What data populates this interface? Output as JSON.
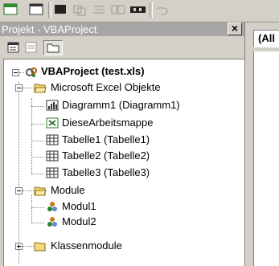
{
  "panel": {
    "title": "Projekt - VBAProject",
    "close_label": "×"
  },
  "code_window": {
    "object_combo": "(All"
  },
  "tree": {
    "project": "VBAProject (test.xls)",
    "excel_objects_folder": "Microsoft Excel Objekte",
    "excel_objects": [
      "Diagramm1 (Diagramm1)",
      "DieseArbeitsmappe",
      "Tabelle1 (Tabelle1)",
      "Tabelle2 (Tabelle2)",
      "Tabelle3 (Tabelle3)"
    ],
    "modules_folder": "Module",
    "modules": [
      "Modul1",
      "Modul2"
    ],
    "classes_folder": "Klassenmodule"
  }
}
